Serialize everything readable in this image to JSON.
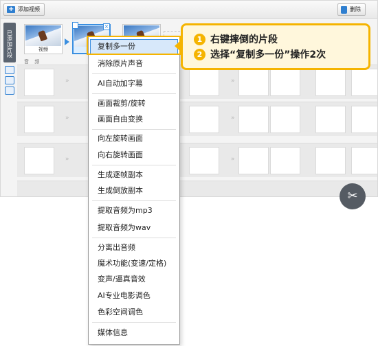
{
  "toolbar": {
    "add_video_label": "添加视频",
    "delete_label": "删除"
  },
  "sidebar": {
    "tab_label": "已添加片段"
  },
  "clips": {
    "first_caption": "视频",
    "drop_hint": "双击添加"
  },
  "track": {
    "audio_label": "音 频"
  },
  "context_menu": {
    "items": [
      {
        "label": "复制多一份"
      },
      {
        "label": "消除原片声音"
      },
      {
        "label": "AI自动加字幕"
      },
      {
        "label": "画面裁剪/旋转"
      },
      {
        "label": "画面自由变换"
      },
      {
        "label": "向左旋转画面"
      },
      {
        "label": "向右旋转画面"
      },
      {
        "label": "生成逐帧副本"
      },
      {
        "label": "生成倒放副本"
      },
      {
        "label": "提取音频为mp3"
      },
      {
        "label": "提取音频为wav"
      },
      {
        "label": "分离出音频"
      },
      {
        "label": "魔术功能(变速/定格)"
      },
      {
        "label": "变声/逼真音效"
      },
      {
        "label": "AI专业电影调色"
      },
      {
        "label": "色彩空间调色"
      },
      {
        "label": "媒体信息"
      }
    ],
    "highlighted_index": 0
  },
  "callout": {
    "steps": [
      {
        "num": "1",
        "text": "右键摔倒的片段"
      },
      {
        "num": "2",
        "text": "选择“复制多一份”操作2次"
      }
    ],
    "accent_color": "#f5b400"
  },
  "colors": {
    "accent_blue": "#3b8fe0",
    "highlight_yellow": "#f5b400"
  }
}
